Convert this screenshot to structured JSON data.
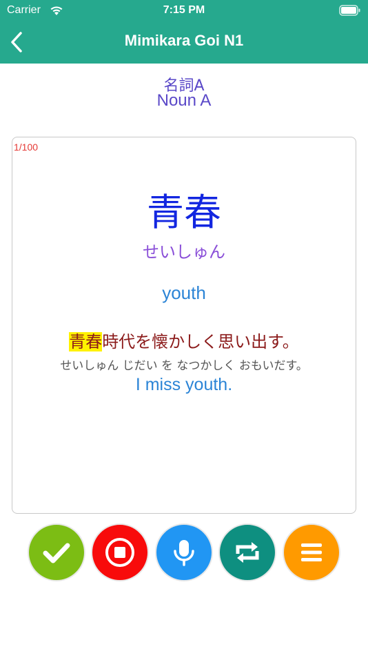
{
  "status_bar": {
    "carrier": "Carrier",
    "time": "7:15 PM"
  },
  "nav": {
    "title": "Mimikara Goi N1"
  },
  "lesson": {
    "title_ja": "名詞A",
    "title_en": "Noun A"
  },
  "card": {
    "counter": "1/100",
    "kanji": "青春",
    "reading": "せいしゅん",
    "meaning": "youth",
    "example": {
      "highlight": "青春",
      "rest": "時代を懐かしく思い出す。"
    },
    "example_reading": "せいしゅん じだい を なつかしく おもいだす。",
    "example_translation": "I miss youth."
  },
  "controls": [
    {
      "icon": "check-icon",
      "color": "#7cbd14"
    },
    {
      "icon": "stop-icon",
      "color": "#f80b0b"
    },
    {
      "icon": "microphone-icon",
      "color": "#2196f3"
    },
    {
      "icon": "repeat-icon",
      "color": "#0e8f80"
    },
    {
      "icon": "menu-icon",
      "color": "#ff9a00"
    }
  ],
  "colors": {
    "header": "#26a98e",
    "lesson_text": "#5a48c8",
    "kanji": "#1226e0",
    "reading": "#8a4fd8",
    "meaning": "#2b84d6",
    "example": "#8b1a1a",
    "highlight": "#fff200",
    "counter": "#e53935"
  }
}
